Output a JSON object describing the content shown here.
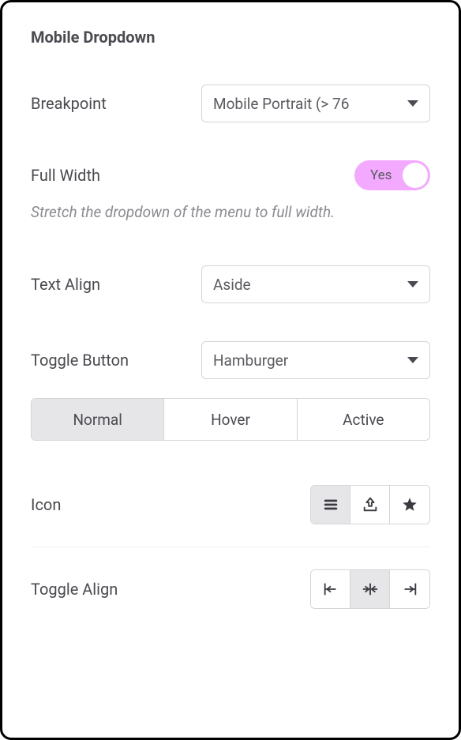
{
  "title": "Mobile Dropdown",
  "breakpoint": {
    "label": "Breakpoint",
    "value": "Mobile Portrait (> 76"
  },
  "full_width": {
    "label": "Full Width",
    "value": "Yes",
    "help": "Stretch the dropdown of the menu to full width."
  },
  "text_align": {
    "label": "Text Align",
    "value": "Aside"
  },
  "toggle_button": {
    "label": "Toggle Button",
    "value": "Hamburger"
  },
  "state_tabs": {
    "normal": "Normal",
    "hover": "Hover",
    "active": "Active"
  },
  "icon": {
    "label": "Icon"
  },
  "toggle_align": {
    "label": "Toggle Align"
  }
}
